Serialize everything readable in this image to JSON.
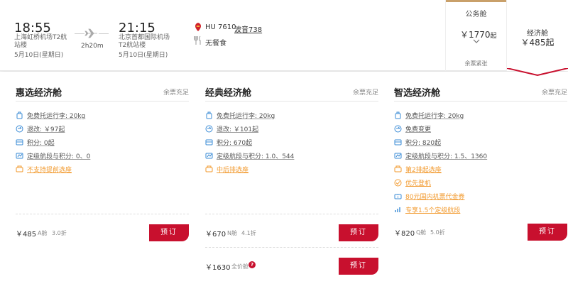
{
  "flight": {
    "dep_time": "18:55",
    "dep_airport": "上海虹桥机场T2航站楼",
    "dep_date": "5月10日(星期日)",
    "arr_time": "21:15",
    "arr_airport": "北京首都国际机场T2航站楼",
    "arr_date": "5月10日(星期日)",
    "duration": "2h20m",
    "flight_no": "HU 7610",
    "aircraft": "波音738",
    "meal": "无餐食",
    "icons": {
      "plane": "plane-icon",
      "airline": "hainan-airlines-logo",
      "meal": "fork-knife-icon"
    }
  },
  "cabins": {
    "official": {
      "title": "公务舱",
      "price": "￥1770",
      "price_suffix": "起",
      "stock": "余票紧张",
      "accent": "#c9a06a"
    },
    "economy": {
      "title": "经济舱",
      "price": "￥485起",
      "accent": "#c8102e"
    }
  },
  "fares": [
    {
      "name": "惠选经济舱",
      "avail": "余票充足",
      "features": [
        {
          "icon": "luggage-icon",
          "text": "免费托运行李: 20kg",
          "orange": false
        },
        {
          "icon": "refund-icon",
          "text": "退改: ￥97起",
          "orange": false
        },
        {
          "icon": "points-icon",
          "text": "积分: 0起",
          "orange": false
        },
        {
          "icon": "grade-points-icon",
          "text": "定级航段与积分: 0、0",
          "orange": false
        },
        {
          "icon": "seat-icon",
          "text": "不支持提前选座",
          "orange": true
        }
      ],
      "prices": [
        {
          "amount": "￥485",
          "cls": "A舱",
          "discount": "3.0折",
          "book": "预订"
        }
      ]
    },
    {
      "name": "经典经济舱",
      "avail": "余票充足",
      "features": [
        {
          "icon": "luggage-icon",
          "text": "免费托运行李: 20kg",
          "orange": false
        },
        {
          "icon": "refund-icon",
          "text": "退改: ￥101起",
          "orange": false
        },
        {
          "icon": "points-icon",
          "text": "积分: 670起",
          "orange": false
        },
        {
          "icon": "grade-points-icon",
          "text": "定级航段与积分: 1.0、544",
          "orange": false
        },
        {
          "icon": "seat-icon",
          "text": "中后排选座",
          "orange": true
        }
      ],
      "prices": [
        {
          "amount": "￥670",
          "cls": "N舱",
          "discount": "4.1折",
          "book": "预订"
        },
        {
          "amount": "￥1630",
          "cls": "全价舱",
          "discount": "",
          "help": "?",
          "book": "预订"
        }
      ]
    },
    {
      "name": "智选经济舱",
      "avail": "余票充足",
      "features": [
        {
          "icon": "luggage-icon",
          "text": "免费托运行李: 20kg",
          "orange": false
        },
        {
          "icon": "refund-icon",
          "text": "免费变更",
          "orange": false
        },
        {
          "icon": "points-icon",
          "text": "积分: 820起",
          "orange": false
        },
        {
          "icon": "grade-points-icon",
          "text": "定级航段与积分: 1.5、1360",
          "orange": false
        },
        {
          "icon": "seat-icon",
          "text": "第2排起选座",
          "orange": true
        },
        {
          "icon": "priority-boarding-icon",
          "text": "优先登机",
          "orange": true
        },
        {
          "icon": "coupon-icon",
          "text": "80元国内机票代金券",
          "orange": true
        },
        {
          "icon": "upgrade-icon",
          "text": "专享1.5个定级航段",
          "orange": true
        }
      ],
      "prices": [
        {
          "amount": "￥820",
          "cls": "Q舱",
          "discount": "5.0折",
          "book": "预订"
        }
      ]
    }
  ]
}
